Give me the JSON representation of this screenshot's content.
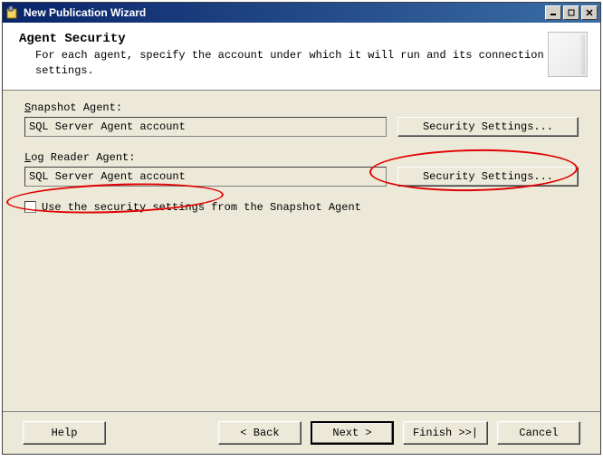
{
  "titlebar": {
    "title": "New Publication Wizard"
  },
  "header": {
    "title": "Agent Security",
    "description": "For each agent, specify the account under which it will run and its connection settings."
  },
  "snapshot": {
    "label": "Snapshot Agent:",
    "value": "SQL Server Agent account",
    "button": "Security Settings..."
  },
  "logreader": {
    "label": "Log Reader Agent:",
    "value": "SQL Server Agent account",
    "button": "Security Settings..."
  },
  "checkbox": {
    "label": "Use the security settings from the Snapshot Agent"
  },
  "footer": {
    "help": "Help",
    "back": "< Back",
    "next": "Next >",
    "finish": "Finish >>|",
    "cancel": "Cancel"
  }
}
